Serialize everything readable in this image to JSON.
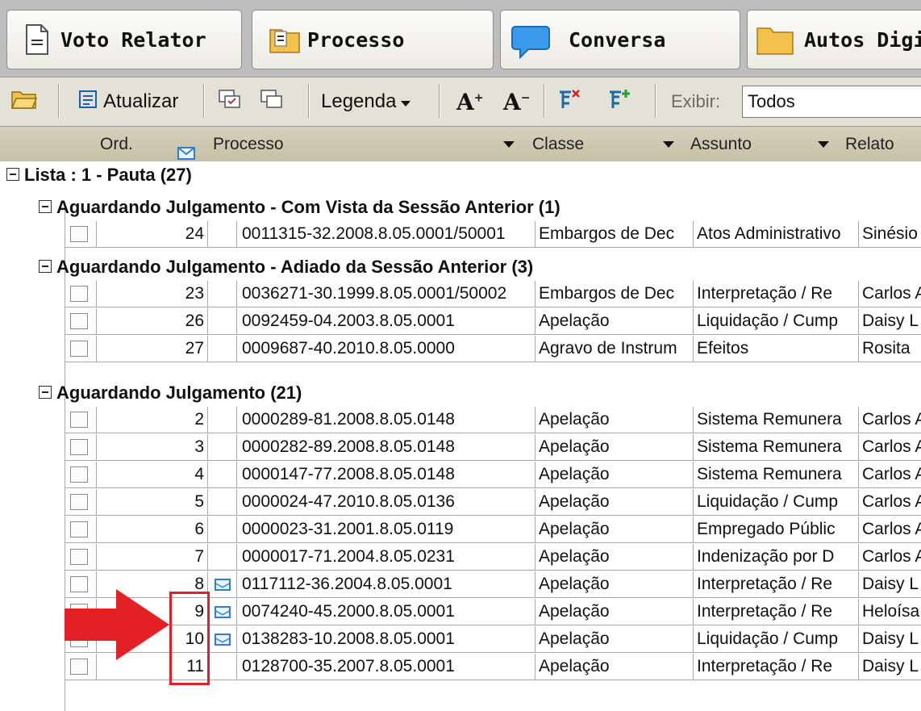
{
  "tabs": [
    {
      "label": "Voto Relator"
    },
    {
      "label": "Processo"
    },
    {
      "label": "Conversa"
    },
    {
      "label": "Autos Digi"
    }
  ],
  "toolbar": {
    "refresh_label": "Atualizar",
    "legend_label": "Legenda",
    "filter_label": "Exibir:",
    "filter_value": "Todos"
  },
  "columns": {
    "ord": "Ord.",
    "processo": "Processo",
    "classe": "Classe",
    "assunto": "Assunto",
    "relator": "Relato"
  },
  "list_title": "Lista : 1 - Pauta (27)",
  "groups": [
    {
      "title": "Aguardando Julgamento - Com Vista da Sessão Anterior (1)",
      "rows": [
        {
          "ord": "24",
          "mail": false,
          "processo": "0011315-32.2008.8.05.0001/50001",
          "classe": "Embargos de Dec",
          "assunto": "Atos Administrativo",
          "relator": "Sinésio"
        }
      ]
    },
    {
      "title": "Aguardando Julgamento - Adiado da Sessão Anterior (3)",
      "rows": [
        {
          "ord": "23",
          "mail": false,
          "processo": "0036271-30.1999.8.05.0001/50002",
          "classe": "Embargos de Dec",
          "assunto": "Interpretação / Re",
          "relator": "Carlos A"
        },
        {
          "ord": "26",
          "mail": false,
          "processo": "0092459-04.2003.8.05.0001",
          "classe": "Apelação",
          "assunto": "Liquidação / Cump",
          "relator": "Daisy L"
        },
        {
          "ord": "27",
          "mail": false,
          "processo": "0009687-40.2010.8.05.0000",
          "classe": "Agravo de Instrum",
          "assunto": "Efeitos",
          "relator": "Rosita"
        }
      ]
    },
    {
      "title": "Aguardando Julgamento (21)",
      "rows": [
        {
          "ord": "2",
          "mail": false,
          "processo": "0000289-81.2008.8.05.0148",
          "classe": "Apelação",
          "assunto": "Sistema Remunera",
          "relator": "Carlos A"
        },
        {
          "ord": "3",
          "mail": false,
          "processo": "0000282-89.2008.8.05.0148",
          "classe": "Apelação",
          "assunto": "Sistema Remunera",
          "relator": "Carlos A"
        },
        {
          "ord": "4",
          "mail": false,
          "processo": "0000147-77.2008.8.05.0148",
          "classe": "Apelação",
          "assunto": "Sistema Remunera",
          "relator": "Carlos A"
        },
        {
          "ord": "5",
          "mail": false,
          "processo": "0000024-47.2010.8.05.0136",
          "classe": "Apelação",
          "assunto": "Liquidação / Cump",
          "relator": "Carlos A"
        },
        {
          "ord": "6",
          "mail": false,
          "processo": "0000023-31.2001.8.05.0119",
          "classe": "Apelação",
          "assunto": "Empregado Públic",
          "relator": "Carlos A"
        },
        {
          "ord": "7",
          "mail": false,
          "processo": "0000017-71.2004.8.05.0231",
          "classe": "Apelação",
          "assunto": "Indenização por D",
          "relator": "Carlos A"
        },
        {
          "ord": "8",
          "mail": true,
          "processo": "0117112-36.2004.8.05.0001",
          "classe": "Apelação",
          "assunto": "Interpretação / Re",
          "relator": "Daisy L"
        },
        {
          "ord": "9",
          "mail": true,
          "processo": "0074240-45.2000.8.05.0001",
          "classe": "Apelação",
          "assunto": "Interpretação / Re",
          "relator": "Heloísa"
        },
        {
          "ord": "10",
          "mail": true,
          "processo": "0138283-10.2008.8.05.0001",
          "classe": "Apelação",
          "assunto": "Liquidação / Cump",
          "relator": "Daisy L"
        },
        {
          "ord": "11",
          "mail": false,
          "processo": "0128700-35.2007.8.05.0001",
          "classe": "Apelação",
          "assunto": "Interpretação / Re",
          "relator": "Daisy L"
        }
      ]
    }
  ],
  "colors": {
    "highlight_box": "#e0202a",
    "arrow": "#e22026",
    "mail_icon": "#2f7fd0",
    "header_bg": "#cfc8b0"
  }
}
